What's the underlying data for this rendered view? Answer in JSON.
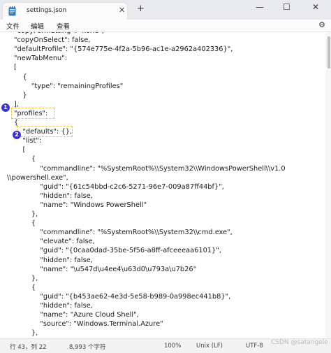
{
  "window": {
    "tab_title": "settings.json",
    "tab_close": "✕",
    "new_tab": "+",
    "minimize": "—",
    "maximize": "☐",
    "close": "✕"
  },
  "menu": {
    "file": "文件",
    "edit": "编辑",
    "view": "查看",
    "settings_icon": "gear-icon"
  },
  "editor": {
    "lines": [
      "\"copyFormatting\": \"none\",",
      "\"copyOnSelect\": false,",
      "\"defaultProfile\": \"{574e775e-4f2a-5b96-ac1e-a2962a402336}\",",
      "\"newTabMenu\":",
      "[",
      "    {",
      "        \"type\": \"remainingProfiles\"",
      "    }",
      "],",
      "\"profiles\":",
      "{",
      "    \"defaults\": {},",
      "    \"list\":",
      "    [",
      "        {",
      "            \"commandline\": \"%SystemRoot%\\\\System32\\\\WindowsPowerShell\\\\v1.0",
      "\\\\powershell.exe\",",
      "            \"guid\": \"{61c54bbd-c2c6-5271-96e7-009a87ff44bf}\",",
      "            \"hidden\": false,",
      "            \"name\": \"Windows PowerShell\"",
      "        },",
      "        {",
      "            \"commandline\": \"%SystemRoot%\\\\System32\\\\cmd.exe\",",
      "            \"elevate\": false,",
      "            \"guid\": \"{0caa0dad-35be-5f56-a8ff-afceeeaa6101}\",",
      "            \"hidden\": false,",
      "            \"name\": \"\\u547d\\u4ee4\\u63d0\\u793a\\u7b26\"",
      "        },",
      "        {",
      "            \"guid\": \"{b453ae62-4e3d-5e58-b989-0a998ec441b8}\",",
      "            \"hidden\": false,",
      "            \"name\": \"Azure Cloud Shell\",",
      "            \"source\": \"Windows.Terminal.Azure\"",
      "        },",
      "        {"
    ]
  },
  "annotations": {
    "badge1": "1",
    "badge2": "2"
  },
  "status": {
    "position": "行 43，列 22",
    "chars": "8,993 个字符",
    "zoom": "100%",
    "eol": "Unix (LF)",
    "encoding": "UTF-8"
  },
  "watermark": "CSDN @satangele",
  "colors": {
    "badge": "#3c35d6",
    "highlight": "#f3c43b"
  }
}
